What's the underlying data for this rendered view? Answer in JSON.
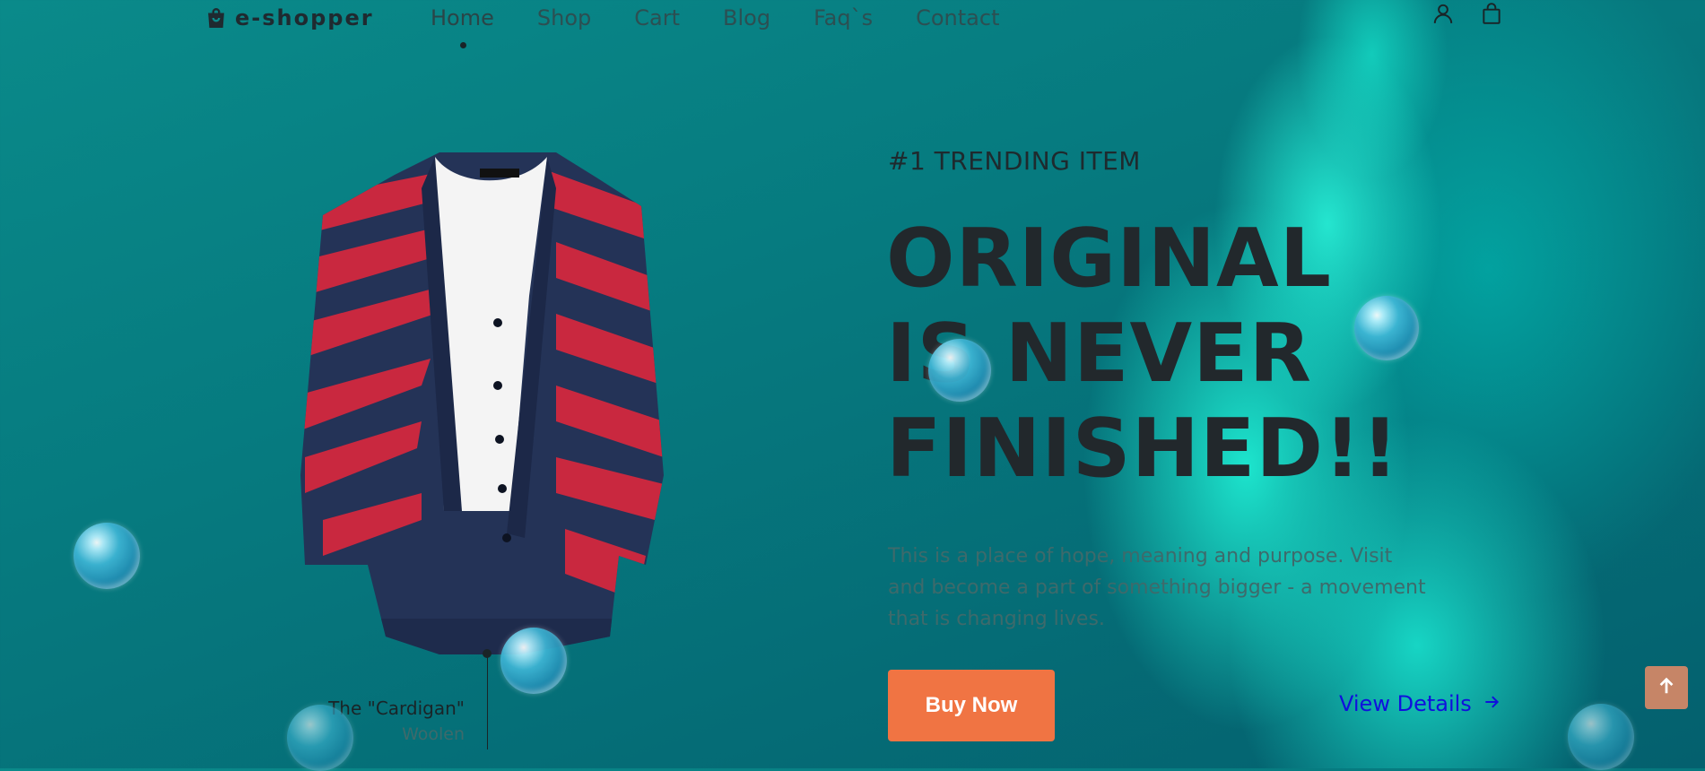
{
  "brand": {
    "name": "e-shopper",
    "icon": "shopping-bag-icon"
  },
  "nav": {
    "links": [
      {
        "label": "Home",
        "active": true
      },
      {
        "label": "Shop"
      },
      {
        "label": "Cart"
      },
      {
        "label": "Blog"
      },
      {
        "label": "Faq`s"
      },
      {
        "label": "Contact"
      }
    ],
    "icons": [
      "user-icon",
      "cart-bag-icon"
    ]
  },
  "hero": {
    "eyebrow": "#1 TRENDING ITEM",
    "headline_lines": [
      "ORIGINAL",
      "IS NEVER",
      "FINISHED!!"
    ],
    "description": "This is a place of hope, meaning and purpose. Visit and become a part of something bigger - a movement that is changing lives.",
    "buy_label": "Buy Now",
    "details_label": "View Details"
  },
  "product": {
    "name": "The \"Cardigan\"",
    "material": "Woolen",
    "image": "striped-cardigan-image"
  },
  "colors": {
    "accent": "#f07443",
    "link": "#1010dd",
    "background": "#0a8a8a",
    "text_dark": "#22282c"
  }
}
